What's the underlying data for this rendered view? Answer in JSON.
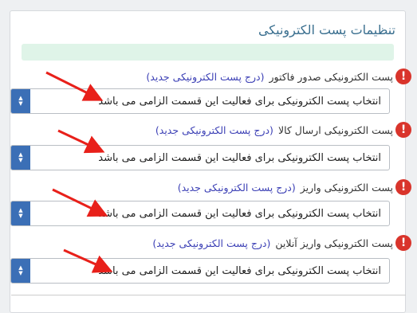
{
  "panel": {
    "title": "تنظیمات پست الکترونیکی"
  },
  "fields": [
    {
      "label": "پست الکترونیکی صدور فاکتور",
      "link": "(درج پست الکترونیکی جدید)",
      "select_value": "انتخاب پست الکترونیکی برای فعالیت این قسمت الزامی می باشد"
    },
    {
      "label": "پست الکترونیکی ارسال کالا",
      "link": "(درج پست الکترونیکی جدید)",
      "select_value": "انتخاب پست الکترونیکی برای فعالیت این قسمت الزامی می باشد"
    },
    {
      "label": "پست الکترونیکی واریز",
      "link": "(درج پست الکترونیکی جدید)",
      "select_value": "انتخاب پست الکترونیکی برای فعالیت این قسمت الزامی می باشد"
    },
    {
      "label": "پست الکترونیکی واریز آنلاین",
      "link": "(درج پست الکترونیکی جدید)",
      "select_value": "انتخاب پست الکترونیکی برای فعالیت این قسمت الزامی می باشد"
    }
  ],
  "icons": {
    "required": "exclamation-icon",
    "select": "updown-chevron-icon",
    "annotation": "red-arrow-icon"
  },
  "colors": {
    "title": "#3a6f8f",
    "link": "#3b3fb5",
    "required_icon": "#d9342b",
    "select_button": "#3b6fb6",
    "annotation_arrow": "#e8201a",
    "alert_strip": "#dff4e8"
  }
}
